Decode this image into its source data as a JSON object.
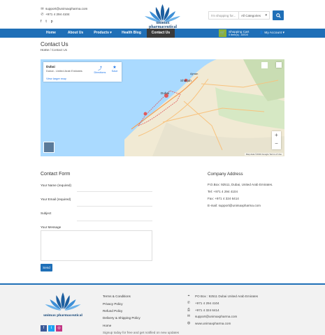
{
  "topbar": {
    "email": "support@unimaxpharma.com",
    "phone": "+971 4 294 4104",
    "social": [
      "f",
      "t",
      "p"
    ]
  },
  "brand": {
    "name": "unimax pharmaceutical",
    "color": "#1a4a7a"
  },
  "search": {
    "placeholder": "I'm shopping for...",
    "category": "All Categories"
  },
  "nav": {
    "items": [
      {
        "label": "Home"
      },
      {
        "label": "About Us"
      },
      {
        "label": "Products ▾"
      },
      {
        "label": "Health Blog"
      },
      {
        "label": "Contact Us"
      }
    ],
    "active_index": 4,
    "color": "#1f6fb7",
    "cart_title": "Shopping Cart",
    "cart_sub": "0 item(s) - AED0",
    "account": "My Account ▾"
  },
  "page": {
    "title": "Contact Us",
    "crumb_home": "Home",
    "crumb_current": "/ Contact Us"
  },
  "map": {
    "place": "Dubai",
    "place_sub": "Dubai - United Arab Emirates",
    "larger": "View larger map",
    "directions": "Directions",
    "save": "Save",
    "labels": [
      "Sharjah",
      "Dubai",
      "Ajman"
    ],
    "footer": "Map data ©2019 Google   Terms of Use"
  },
  "form": {
    "heading": "Contact Form",
    "name_label": "Your Name (required)",
    "email_label": "Your Email (required)",
    "subject_label": "Subject",
    "message_label": "Your Message",
    "send_label": "Send"
  },
  "company": {
    "heading": "Company Address",
    "po": "P.O.Box: 92511, Dubai, United Arab Emirates.",
    "tel": "Tel: +971 4 294 4104",
    "fax": "Fax: +971 4 324 6414",
    "email": "E-mail: support@unimaxpharma.com"
  },
  "footer": {
    "links": [
      "Terms & Conditions",
      "Privacy Policy",
      "Refund Policy",
      "Delivery & Shipping Policy",
      "Home",
      "Signup today for free and get notified on new updates"
    ],
    "info": [
      {
        "icon": "map-marker-icon",
        "glyph": "⌖",
        "text": "PO Box : 92511 Dubai United Arab Emirates"
      },
      {
        "icon": "phone-icon",
        "glyph": "✆",
        "text": "+971 4 294 4104"
      },
      {
        "icon": "fax-icon",
        "glyph": "⎙",
        "text": "+971 4 324 6414"
      },
      {
        "icon": "envelope-icon",
        "glyph": "✉",
        "text": "support@unimaxpharma.com"
      },
      {
        "icon": "globe-icon",
        "glyph": "◍",
        "text": "www.unimaxpharma.com"
      }
    ],
    "social": [
      {
        "label": "f",
        "color": "#3b5998"
      },
      {
        "label": "t",
        "color": "#1da1f2"
      },
      {
        "label": "◎",
        "color": "#c13584"
      }
    ]
  }
}
